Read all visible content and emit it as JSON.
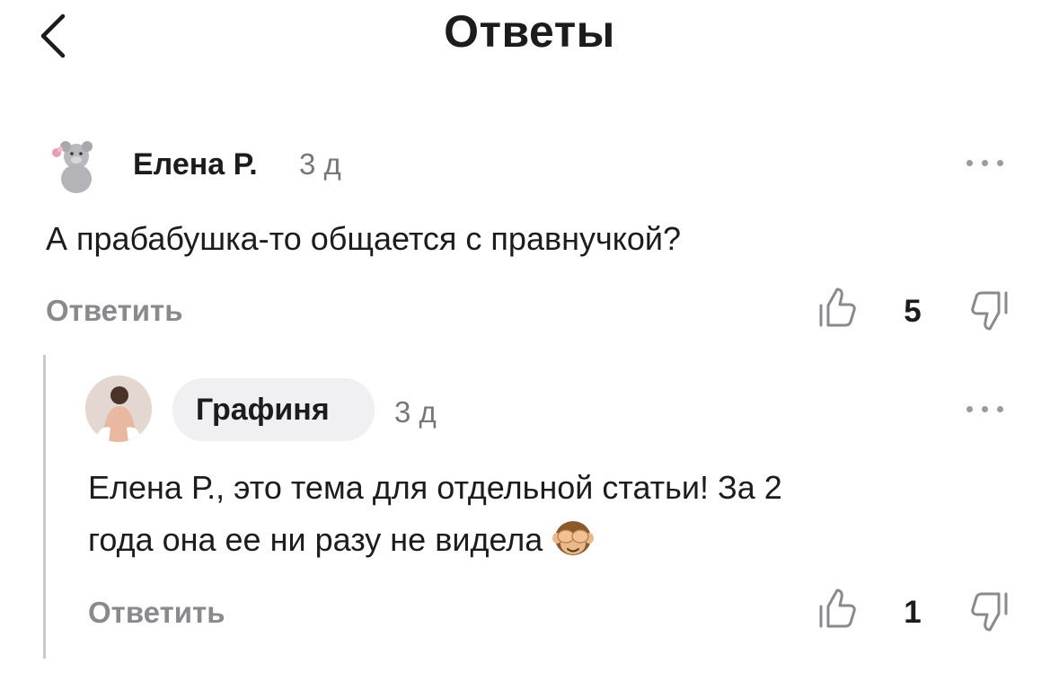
{
  "header": {
    "title": "Ответы",
    "back_icon": "chevron-left-icon"
  },
  "comments": [
    {
      "author": "Елена Р.",
      "time": "3 д",
      "text": "А прабабушка-то общается с правнучкой?",
      "reply_label": "Ответить",
      "score": "5",
      "avatar": "teddy-bear-avatar"
    },
    {
      "author": "Графиня",
      "time": "3 д",
      "text_line1": "Елена Р., это тема для отдельной статьи! За 2",
      "text_line2": "года она ее ни разу не видела",
      "emoji": "see-no-evil-monkey",
      "reply_label": "Ответить",
      "score": "1",
      "avatar": "woman-back-avatar"
    }
  ],
  "colors": {
    "text": "#1c1c1e",
    "muted": "#8a8a8e",
    "icon": "#9a9aa0",
    "pill": "#f0f0f2",
    "thread_line": "#c9c9cc"
  }
}
